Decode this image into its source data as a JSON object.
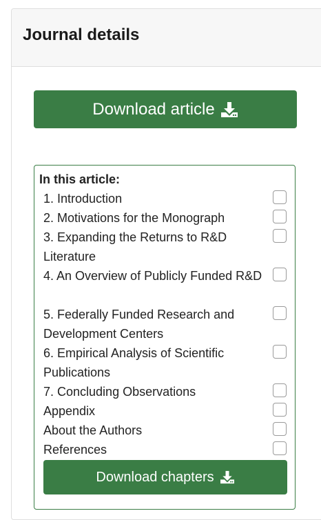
{
  "panel": {
    "title": "Journal details",
    "download_article_label": "Download article",
    "download_icon": "download-icon"
  },
  "toc": {
    "heading": "In this article:",
    "items": [
      {
        "label": "1. Introduction"
      },
      {
        "label": "2. Motivations for the Monograph"
      },
      {
        "label": "3. Expanding the Returns to R&D Literature"
      },
      {
        "label": "4. An Overview of Publicly Funded R&D"
      },
      {
        "label": "5. Federally Funded Research and Development Centers"
      },
      {
        "label": "6. Empirical Analysis of Scientific Publications"
      },
      {
        "label": "7. Concluding Observations"
      },
      {
        "label": "Appendix"
      },
      {
        "label": "About the Authors"
      },
      {
        "label": "References"
      }
    ],
    "download_chapters_label": "Download chapters"
  },
  "colors": {
    "accent": "#3a7d45",
    "header_bg": "#f7f7f7",
    "border": "#dedede"
  }
}
